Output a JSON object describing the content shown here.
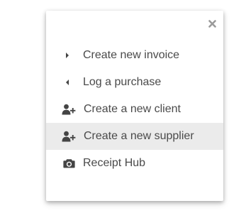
{
  "menu": {
    "close_icon": "close-icon",
    "items": [
      {
        "label": "Create new invoice",
        "icon": "caret-right-icon"
      },
      {
        "label": "Log a purchase",
        "icon": "caret-left-icon"
      },
      {
        "label": "Create a new client",
        "icon": "user-plus-icon"
      },
      {
        "label": "Create a new supplier",
        "icon": "user-plus-icon",
        "highlighted": true
      },
      {
        "label": "Receipt Hub",
        "icon": "camera-icon"
      }
    ]
  },
  "colors": {
    "text": "#4a4a4a",
    "icon": "#444444",
    "close": "#9a9a9a",
    "highlight": "#ebebeb"
  }
}
